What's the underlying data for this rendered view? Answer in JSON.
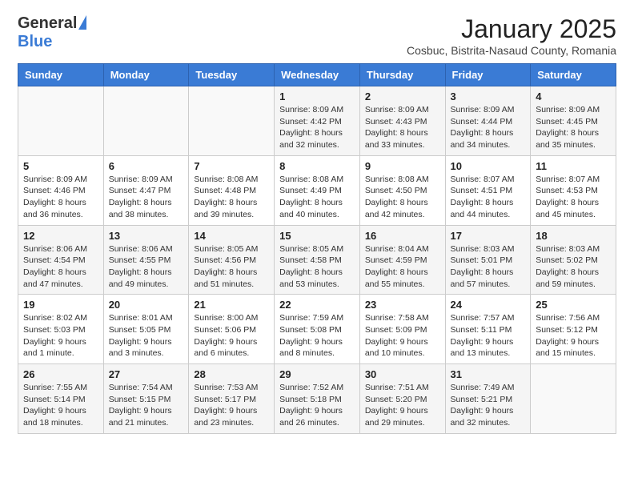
{
  "header": {
    "logo_general": "General",
    "logo_blue": "Blue",
    "month_title": "January 2025",
    "location": "Cosbuc, Bistrita-Nasaud County, Romania"
  },
  "weekdays": [
    "Sunday",
    "Monday",
    "Tuesday",
    "Wednesday",
    "Thursday",
    "Friday",
    "Saturday"
  ],
  "weeks": [
    [
      {
        "day": "",
        "info": ""
      },
      {
        "day": "",
        "info": ""
      },
      {
        "day": "",
        "info": ""
      },
      {
        "day": "1",
        "info": "Sunrise: 8:09 AM\nSunset: 4:42 PM\nDaylight: 8 hours and 32 minutes."
      },
      {
        "day": "2",
        "info": "Sunrise: 8:09 AM\nSunset: 4:43 PM\nDaylight: 8 hours and 33 minutes."
      },
      {
        "day": "3",
        "info": "Sunrise: 8:09 AM\nSunset: 4:44 PM\nDaylight: 8 hours and 34 minutes."
      },
      {
        "day": "4",
        "info": "Sunrise: 8:09 AM\nSunset: 4:45 PM\nDaylight: 8 hours and 35 minutes."
      }
    ],
    [
      {
        "day": "5",
        "info": "Sunrise: 8:09 AM\nSunset: 4:46 PM\nDaylight: 8 hours and 36 minutes."
      },
      {
        "day": "6",
        "info": "Sunrise: 8:09 AM\nSunset: 4:47 PM\nDaylight: 8 hours and 38 minutes."
      },
      {
        "day": "7",
        "info": "Sunrise: 8:08 AM\nSunset: 4:48 PM\nDaylight: 8 hours and 39 minutes."
      },
      {
        "day": "8",
        "info": "Sunrise: 8:08 AM\nSunset: 4:49 PM\nDaylight: 8 hours and 40 minutes."
      },
      {
        "day": "9",
        "info": "Sunrise: 8:08 AM\nSunset: 4:50 PM\nDaylight: 8 hours and 42 minutes."
      },
      {
        "day": "10",
        "info": "Sunrise: 8:07 AM\nSunset: 4:51 PM\nDaylight: 8 hours and 44 minutes."
      },
      {
        "day": "11",
        "info": "Sunrise: 8:07 AM\nSunset: 4:53 PM\nDaylight: 8 hours and 45 minutes."
      }
    ],
    [
      {
        "day": "12",
        "info": "Sunrise: 8:06 AM\nSunset: 4:54 PM\nDaylight: 8 hours and 47 minutes."
      },
      {
        "day": "13",
        "info": "Sunrise: 8:06 AM\nSunset: 4:55 PM\nDaylight: 8 hours and 49 minutes."
      },
      {
        "day": "14",
        "info": "Sunrise: 8:05 AM\nSunset: 4:56 PM\nDaylight: 8 hours and 51 minutes."
      },
      {
        "day": "15",
        "info": "Sunrise: 8:05 AM\nSunset: 4:58 PM\nDaylight: 8 hours and 53 minutes."
      },
      {
        "day": "16",
        "info": "Sunrise: 8:04 AM\nSunset: 4:59 PM\nDaylight: 8 hours and 55 minutes."
      },
      {
        "day": "17",
        "info": "Sunrise: 8:03 AM\nSunset: 5:01 PM\nDaylight: 8 hours and 57 minutes."
      },
      {
        "day": "18",
        "info": "Sunrise: 8:03 AM\nSunset: 5:02 PM\nDaylight: 8 hours and 59 minutes."
      }
    ],
    [
      {
        "day": "19",
        "info": "Sunrise: 8:02 AM\nSunset: 5:03 PM\nDaylight: 9 hours and 1 minute."
      },
      {
        "day": "20",
        "info": "Sunrise: 8:01 AM\nSunset: 5:05 PM\nDaylight: 9 hours and 3 minutes."
      },
      {
        "day": "21",
        "info": "Sunrise: 8:00 AM\nSunset: 5:06 PM\nDaylight: 9 hours and 6 minutes."
      },
      {
        "day": "22",
        "info": "Sunrise: 7:59 AM\nSunset: 5:08 PM\nDaylight: 9 hours and 8 minutes."
      },
      {
        "day": "23",
        "info": "Sunrise: 7:58 AM\nSunset: 5:09 PM\nDaylight: 9 hours and 10 minutes."
      },
      {
        "day": "24",
        "info": "Sunrise: 7:57 AM\nSunset: 5:11 PM\nDaylight: 9 hours and 13 minutes."
      },
      {
        "day": "25",
        "info": "Sunrise: 7:56 AM\nSunset: 5:12 PM\nDaylight: 9 hours and 15 minutes."
      }
    ],
    [
      {
        "day": "26",
        "info": "Sunrise: 7:55 AM\nSunset: 5:14 PM\nDaylight: 9 hours and 18 minutes."
      },
      {
        "day": "27",
        "info": "Sunrise: 7:54 AM\nSunset: 5:15 PM\nDaylight: 9 hours and 21 minutes."
      },
      {
        "day": "28",
        "info": "Sunrise: 7:53 AM\nSunset: 5:17 PM\nDaylight: 9 hours and 23 minutes."
      },
      {
        "day": "29",
        "info": "Sunrise: 7:52 AM\nSunset: 5:18 PM\nDaylight: 9 hours and 26 minutes."
      },
      {
        "day": "30",
        "info": "Sunrise: 7:51 AM\nSunset: 5:20 PM\nDaylight: 9 hours and 29 minutes."
      },
      {
        "day": "31",
        "info": "Sunrise: 7:49 AM\nSunset: 5:21 PM\nDaylight: 9 hours and 32 minutes."
      },
      {
        "day": "",
        "info": ""
      }
    ]
  ]
}
